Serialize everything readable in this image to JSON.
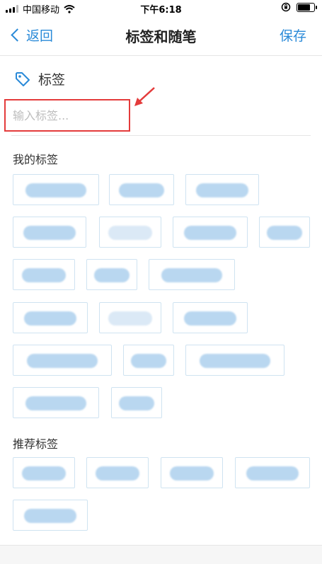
{
  "status_bar": {
    "carrier": "中国移动",
    "time": "下午6:18"
  },
  "nav": {
    "back_label": "返回",
    "title": "标签和随笔",
    "save_label": "保存"
  },
  "section": {
    "label": "标签",
    "input_placeholder": "输入标签...",
    "input_value": ""
  },
  "my_tags": {
    "title": "我的标签",
    "count": 17
  },
  "recommended_tags": {
    "title": "推荐标签",
    "count": 5
  },
  "colors": {
    "accent": "#2a8ad8",
    "highlight": "#e43b3b",
    "chip_border": "#cfe3f1"
  }
}
